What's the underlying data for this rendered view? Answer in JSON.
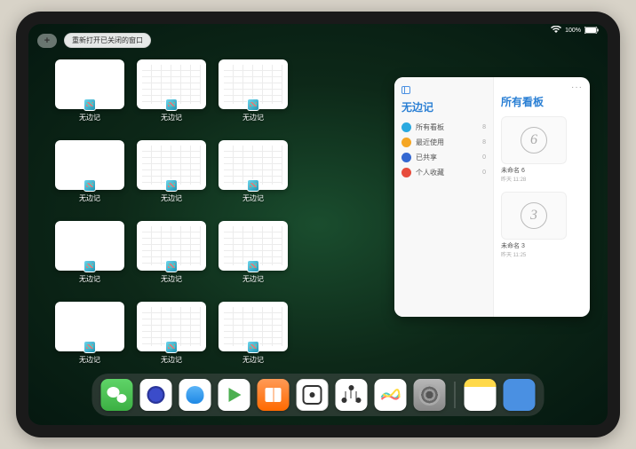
{
  "statusbar": {
    "battery_text": "100%"
  },
  "topbar": {
    "plus_label": "+",
    "reopen_label": "重新打开已关闭的窗口"
  },
  "thumbnails": {
    "app_label": "无边记",
    "items": [
      {
        "label": "无边记",
        "content": false
      },
      {
        "label": "无边记",
        "content": true
      },
      {
        "label": "无边记",
        "content": true
      },
      {
        "label": "无边记",
        "content": false
      },
      {
        "label": "无边记",
        "content": true
      },
      {
        "label": "无边记",
        "content": true
      },
      {
        "label": "无边记",
        "content": false
      },
      {
        "label": "无边记",
        "content": true
      },
      {
        "label": "无边记",
        "content": true
      },
      {
        "label": "无边记",
        "content": false
      },
      {
        "label": "无边记",
        "content": true
      },
      {
        "label": "无边记",
        "content": true
      }
    ],
    "row3_count": 3,
    "row4_count": 3
  },
  "panel": {
    "left_title": "无边记",
    "right_title": "所有看板",
    "more": "···",
    "categories": [
      {
        "label": "所有看板",
        "count": "8",
        "color": "#2aa9e0"
      },
      {
        "label": "最近使用",
        "count": "8",
        "color": "#f5a623"
      },
      {
        "label": "已共享",
        "count": "0",
        "color": "#3468d1"
      },
      {
        "label": "个人收藏",
        "count": "0",
        "color": "#e74c3c"
      }
    ],
    "boards": [
      {
        "digit": "6",
        "name": "未命名 6",
        "time": "昨天 11:28"
      },
      {
        "digit": "3",
        "name": "未命名 3",
        "time": "昨天 11:25"
      }
    ]
  },
  "dock": {
    "apps": [
      {
        "name": "wechat-icon"
      },
      {
        "name": "quark-icon"
      },
      {
        "name": "qqbrowser-icon"
      },
      {
        "name": "play-icon"
      },
      {
        "name": "books-icon"
      },
      {
        "name": "dice-icon"
      },
      {
        "name": "nodes-icon"
      },
      {
        "name": "freeform-icon"
      },
      {
        "name": "settings-icon"
      }
    ],
    "recent": [
      {
        "name": "notes-icon"
      },
      {
        "name": "app-folder-icon"
      }
    ]
  }
}
